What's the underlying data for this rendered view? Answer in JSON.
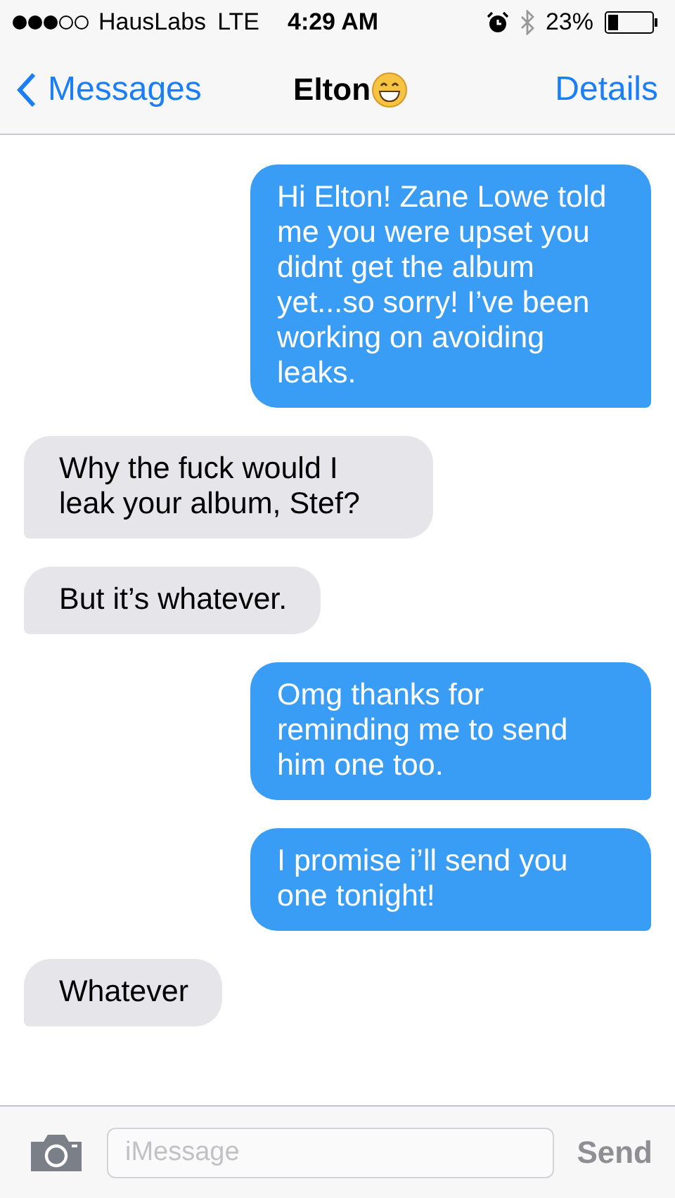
{
  "status_bar": {
    "carrier": "HausLabs",
    "network": "LTE",
    "time": "4:29 AM",
    "battery": "23%"
  },
  "nav_bar": {
    "back": "Messages",
    "title": "Elton",
    "details": "Details"
  },
  "messages": [
    {
      "kind": "sent",
      "text": "Hi Elton! Zane Lowe told me you were upset you didnt get the album yet...so sorry! I’ve been working on avoiding leaks."
    },
    {
      "kind": "received",
      "text": "Why the fuck would I leak your album, Stef?"
    },
    {
      "kind": "received",
      "text": "But it’s whatever."
    },
    {
      "kind": "sent",
      "text": "Omg thanks for reminding me to send him one too."
    },
    {
      "kind": "sent",
      "text": "I promise i’ll send you one tonight!"
    },
    {
      "kind": "received",
      "text": "Whatever"
    }
  ],
  "compose": {
    "placeholder": "iMessage",
    "send": "Send"
  }
}
